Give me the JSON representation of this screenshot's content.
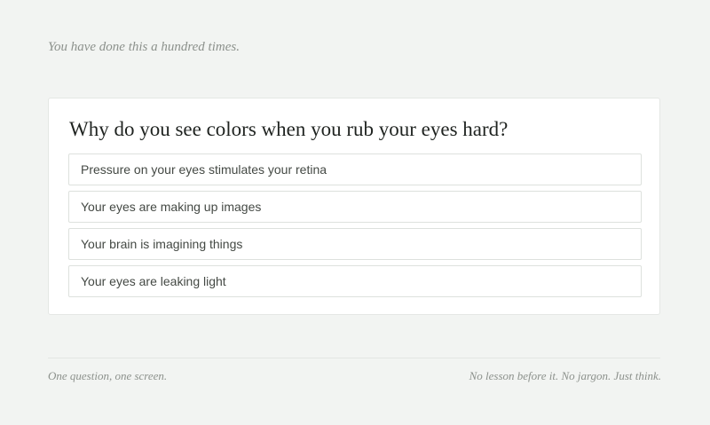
{
  "intro": "You have done this a hundred times.",
  "question": {
    "title": "Why do you see colors when you rub your eyes hard?",
    "options": [
      "Pressure on your eyes stimulates your retina",
      "Your eyes are making up images",
      "Your brain is imagining things",
      "Your eyes are leaking light"
    ]
  },
  "footer": {
    "left": "One question, one screen.",
    "right": "No lesson before it. No jargon. Just think."
  }
}
